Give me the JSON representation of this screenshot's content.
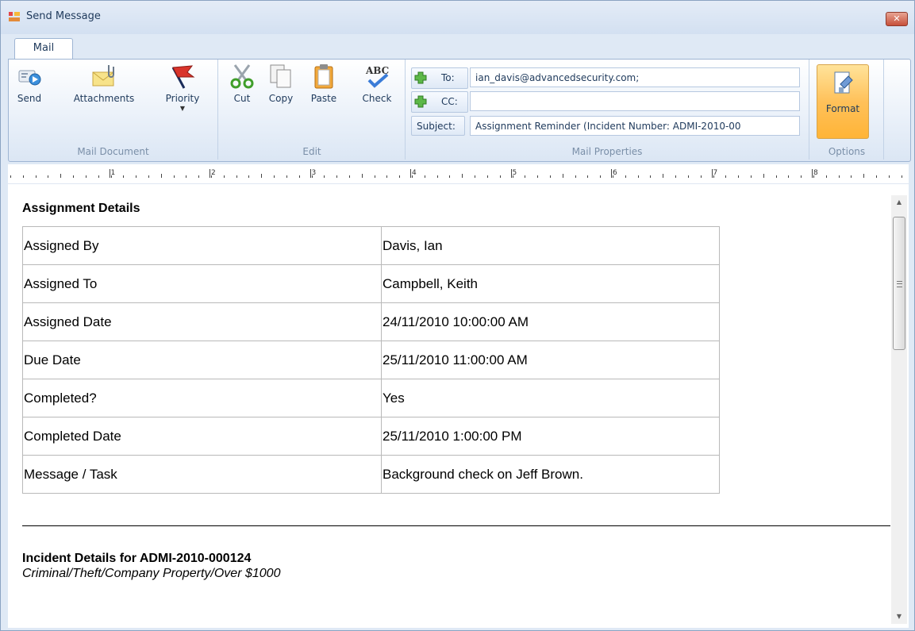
{
  "window": {
    "title": "Send Message",
    "close_glyph": "✕"
  },
  "tabs": [
    {
      "label": "Mail"
    }
  ],
  "ribbon": {
    "groups": {
      "mail_document": {
        "label": "Mail Document",
        "buttons": {
          "send": "Send",
          "attachments": "Attachments",
          "priority": "Priority"
        }
      },
      "edit": {
        "label": "Edit",
        "buttons": {
          "cut": "Cut",
          "copy": "Copy",
          "paste": "Paste",
          "check": "Check"
        }
      },
      "mail_properties": {
        "label": "Mail Properties",
        "to_label": "To:",
        "to_value": "ian_davis@advancedsecurity.com;",
        "cc_label": "CC:",
        "cc_value": "",
        "subject_label": "Subject:",
        "subject_value": "Assignment Reminder (Incident Number: ADMI-2010-00"
      },
      "options": {
        "label": "Options",
        "buttons": {
          "format": "Format"
        }
      }
    },
    "icons": {
      "send": "send-icon",
      "attachments": "envelope-paperclip-icon",
      "priority": "red-flag-icon",
      "cut": "scissors-icon",
      "copy": "copy-icon",
      "paste": "clipboard-icon",
      "check": "spellcheck-icon",
      "add_to": "green-plus-icon",
      "add_cc": "green-plus-icon",
      "format": "format-painter-icon"
    }
  },
  "ruler": {
    "marks": [
      "1",
      "2",
      "3",
      "4",
      "5",
      "6",
      "7",
      "8"
    ]
  },
  "document": {
    "heading": "Assignment Details",
    "rows": [
      {
        "label": "Assigned By",
        "value": "Davis, Ian"
      },
      {
        "label": "Assigned To",
        "value": "Campbell, Keith"
      },
      {
        "label": "Assigned Date",
        "value": "24/11/2010 10:00:00 AM"
      },
      {
        "label": "Due Date",
        "value": "25/11/2010 11:00:00 AM"
      },
      {
        "label": "Completed?",
        "value": "Yes"
      },
      {
        "label": "Completed Date",
        "value": "25/11/2010 1:00:00 PM"
      },
      {
        "label": "Message / Task",
        "value": "Background check on Jeff Brown."
      }
    ],
    "incident_title": "Incident Details for ADMI-2010-000124",
    "incident_category": "Criminal/Theft/Company Property/Over $1000"
  },
  "colors": {
    "accent": "#ffc15a",
    "title_text": "#1e395b",
    "close": "#c7503a"
  }
}
